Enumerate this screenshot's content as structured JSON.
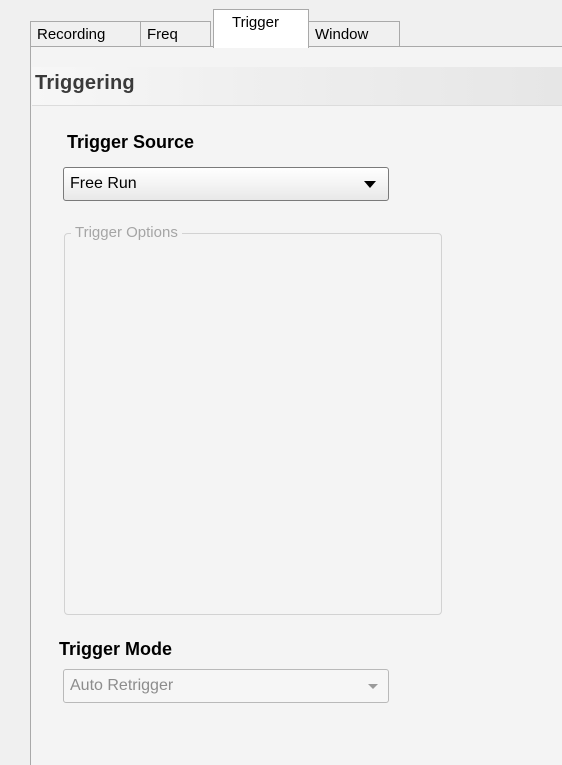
{
  "tabs": [
    {
      "label": "Recording",
      "selected": false
    },
    {
      "label": "Freq",
      "selected": false
    },
    {
      "label": "Trigger",
      "selected": true
    },
    {
      "label": "Window",
      "selected": false
    }
  ],
  "section": {
    "title": "Triggering"
  },
  "trigger_source": {
    "label": "Trigger Source",
    "value": "Free Run",
    "enabled": true
  },
  "trigger_options": {
    "title": "Trigger Options",
    "enabled": false
  },
  "trigger_mode": {
    "label": "Trigger Mode",
    "value": "Auto Retrigger",
    "enabled": false
  },
  "icons": {
    "dropdown": "chevron-down-icon"
  }
}
